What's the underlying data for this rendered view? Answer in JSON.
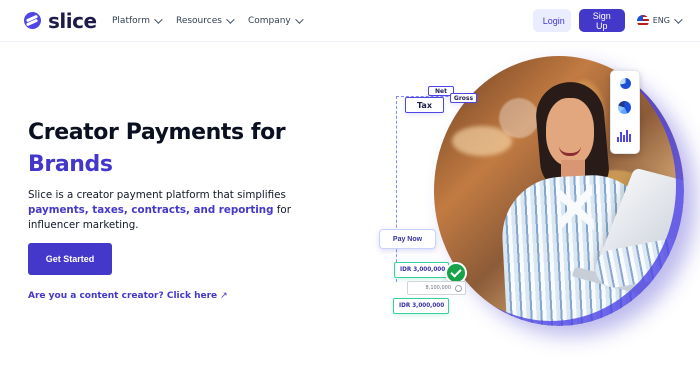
{
  "brand": {
    "name": "slice",
    "logo_icon": "slice-logo-icon"
  },
  "nav": {
    "items": [
      {
        "label": "Platform",
        "icon": "chevron-down-icon"
      },
      {
        "label": "Resources",
        "icon": "chevron-down-icon"
      },
      {
        "label": "Company",
        "icon": "chevron-down-icon"
      }
    ],
    "login_label": "Login",
    "signup_label": "Sign Up",
    "language_label": "ENG",
    "language_icon": "united-states-flag-icon"
  },
  "hero": {
    "title_line_1": "Creator Payments for",
    "title_line_2": "Brands",
    "description_prefix": "Slice is a creator payment platform that simplifies ",
    "description_highlight": "payments, taxes, contracts, and reporting",
    "description_suffix": " for influencer marketing.",
    "cta_label": "Get Started",
    "creator_link_label": "Are you a content creator? Click here",
    "creator_link_icon": "arrow-up-right-icon"
  },
  "visual": {
    "tags": {
      "net": "Net",
      "tax": "Tax",
      "gross": "Gross"
    },
    "pay_now_label": "Pay Now",
    "amounts": {
      "first": "IDR 3,000,000",
      "pending": "8,100,000",
      "second": "IDR 3,000,000"
    },
    "icons": {
      "success": "green-check-icon",
      "pending": "pending-check-icon",
      "dashboard": "analytics-card-icon"
    },
    "colors": {
      "brand": "#4338ca",
      "success": "#16a34a",
      "border": "#818cf8"
    }
  }
}
